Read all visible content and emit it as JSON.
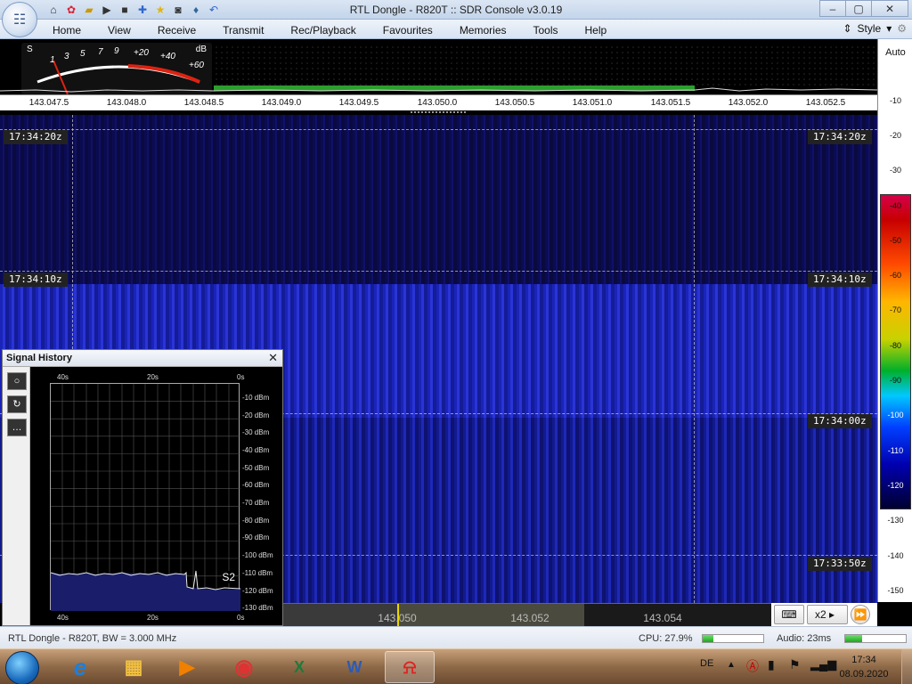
{
  "window": {
    "title": "RTL Dongle - R820T :: SDR Console v3.0.19",
    "controls": [
      "–",
      "▢",
      "✕"
    ]
  },
  "quick_access": [
    "home-icon",
    "lifebuoy-icon",
    "folder-icon",
    "play-icon",
    "stop-icon",
    "plus-icon",
    "star-icon",
    "camera-icon",
    "drop-icon",
    "undo-icon"
  ],
  "menu": [
    "Home",
    "View",
    "Receive",
    "Transmit",
    "Rec/Playback",
    "Favourites",
    "Memories",
    "Tools",
    "Help"
  ],
  "style_label": "Style",
  "meter": {
    "s_label": "S",
    "db_label": "dB",
    "scale": [
      "1",
      "3",
      "5",
      "7",
      "9",
      "+20",
      "+40",
      "+60"
    ]
  },
  "frequency_axis": [
    "143.047.5",
    "143.048.0",
    "143.048.5",
    "143.049.0",
    "143.049.5",
    "143.050.0",
    "143.050.5",
    "143.051.0",
    "143.051.5",
    "143.052.0",
    "143.052.5"
  ],
  "waterfall": {
    "times": [
      "17:34:20z",
      "17:34:10z",
      "17:34:00z",
      "17:33:50z"
    ]
  },
  "db_scale": {
    "auto": "Auto",
    "labels": [
      "-10",
      "-20",
      "-30",
      "-40",
      "-50",
      "-60",
      "-70",
      "-80",
      "-90",
      "-100",
      "-110",
      "-120",
      "-130",
      "-140",
      "-150"
    ]
  },
  "tuning": {
    "labels": [
      "143.050",
      "143.052",
      "143.054"
    ],
    "zoom": "x2"
  },
  "signal_history": {
    "title": "Signal History",
    "time_labels": [
      "40s",
      "20s",
      "0s"
    ],
    "db_labels": [
      "-10 dBm",
      "-20 dBm",
      "-30 dBm",
      "-40 dBm",
      "-50 dBm",
      "-60 dBm",
      "-70 dBm",
      "-80 dBm",
      "-90 dBm",
      "-100 dBm",
      "-110 dBm",
      "-120 dBm",
      "-130 dBm"
    ],
    "s_value": "S2",
    "tools": [
      "○",
      "↻",
      "…"
    ]
  },
  "status": {
    "device": "RTL Dongle - R820T, BW = 3.000 MHz",
    "cpu": "CPU: 27.9%",
    "cpu_fraction": 0.18,
    "audio": "Audio: 23ms",
    "audio_fraction": 0.28
  },
  "taskbar": {
    "apps": [
      "ie-icon",
      "explorer-icon",
      "media-player-icon",
      "chrome-icon",
      "excel-icon",
      "word-icon",
      "sdr-console-icon"
    ],
    "lang": "DE",
    "time": "17:34",
    "date": "08.09.2020"
  }
}
